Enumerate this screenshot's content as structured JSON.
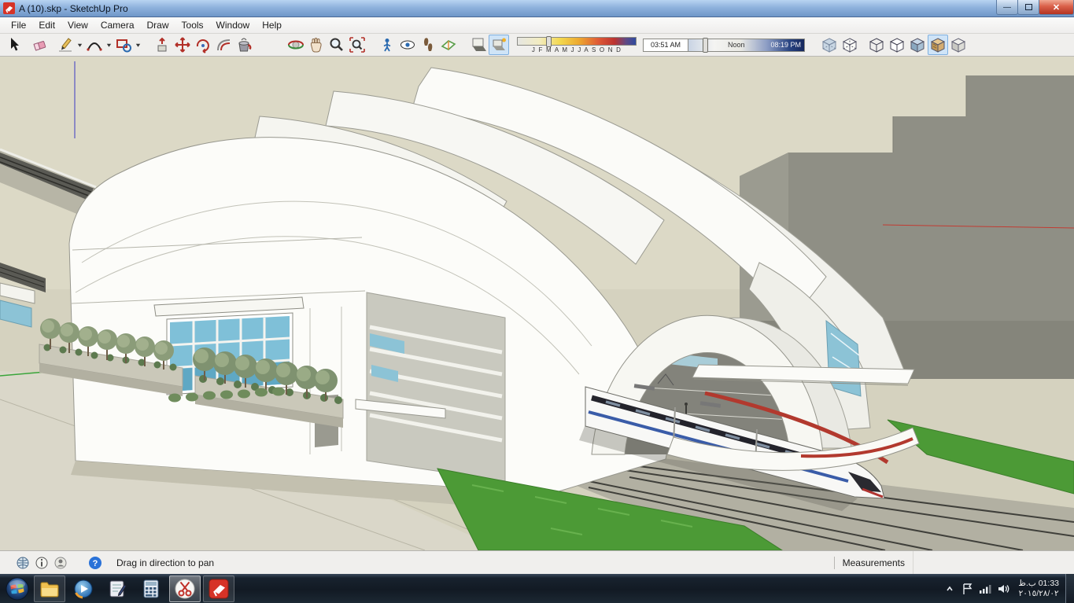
{
  "window": {
    "title": "A (10).skp - SketchUp Pro",
    "controls": [
      "minimize-button",
      "maximize-button",
      "close-button"
    ]
  },
  "menu": {
    "items": [
      "File",
      "Edit",
      "View",
      "Camera",
      "Draw",
      "Tools",
      "Window",
      "Help"
    ]
  },
  "toolbar": {
    "tools": [
      "select-tool",
      "eraser-tool",
      "line-tool",
      "arc-tool",
      "shapes-tool",
      "push-pull-tool",
      "move-tool",
      "rotate-tool",
      "offset-tool",
      "paint-bucket-tool",
      "orbit-tool",
      "pan-tool",
      "zoom-tool",
      "zoom-extents-tool",
      "position-camera-tool",
      "look-around-tool",
      "walk-tool",
      "section-plane-tool",
      "shadow-dialog-button",
      "shadow-toggle-button"
    ],
    "style_buttons": [
      "xray-style",
      "back-edges-style",
      "wireframe-style",
      "hidden-line-style",
      "shaded-style",
      "shaded-textures-style",
      "monochrome-style"
    ],
    "shadow": {
      "months": "J F M A M J J A S O N D",
      "time_start": "03:51 AM",
      "time_noon": "Noon",
      "time_end": "08:19 PM"
    }
  },
  "statusbar": {
    "icons": [
      "geolocation-icon",
      "credits-icon",
      "signin-icon",
      "help-icon"
    ],
    "hint": "Drag in direction to pan",
    "measurements_label": "Measurements",
    "measurements_value": ""
  },
  "taskbar": {
    "apps": [
      "start-button",
      "explorer",
      "media-player",
      "journal",
      "calculator",
      "snipping-tool",
      "sketchup"
    ],
    "tray_icons": [
      "hidden-icons-chevron",
      "action-center-icon",
      "network-icon",
      "volume-icon"
    ],
    "clock_time": "01:33 ب.ظ",
    "clock_date": "٢٠١٥/٢٨/٠٢"
  }
}
